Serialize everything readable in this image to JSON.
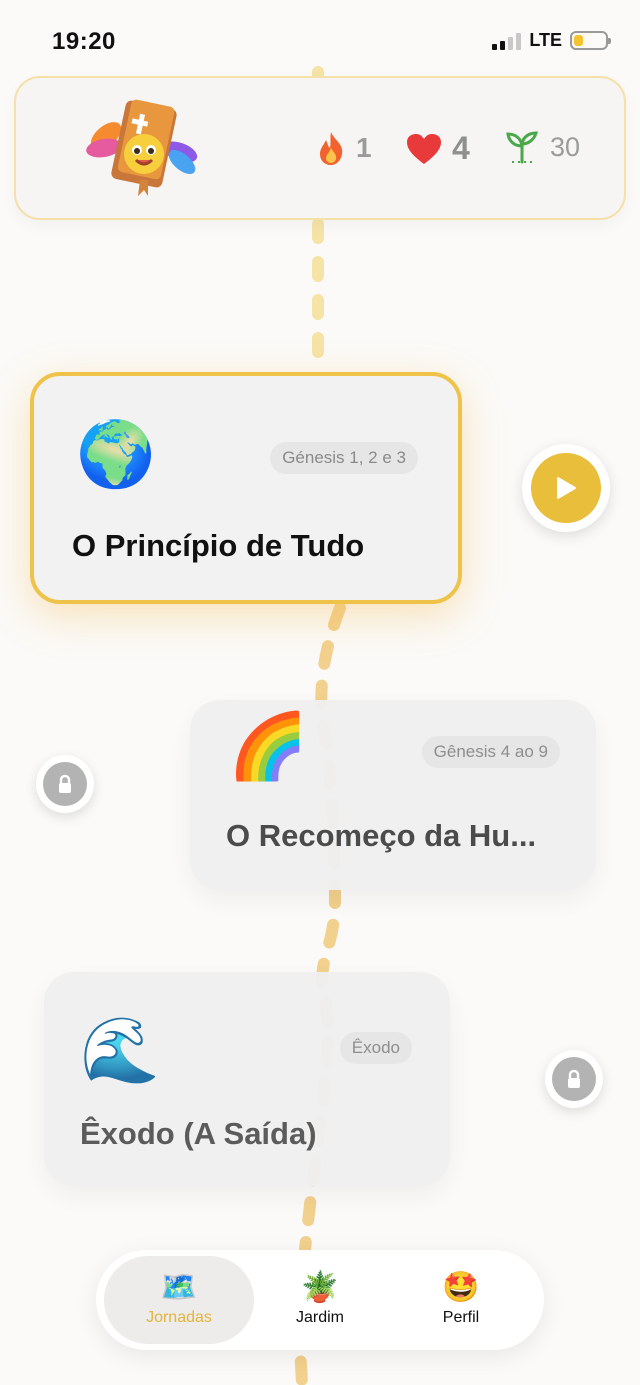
{
  "status_bar": {
    "time": "19:20",
    "network": "LTE"
  },
  "header": {
    "streak": "1",
    "lives": "4",
    "seeds": "30"
  },
  "journeys": [
    {
      "emoji": "🌍",
      "reference": "Génesis 1, 2 e 3",
      "title": "O Princípio de Tudo",
      "state": "active"
    },
    {
      "emoji": "🌈",
      "reference": "Gênesis 4 ao 9",
      "title": "O Recomeço da Hu...",
      "state": "locked"
    },
    {
      "emoji": "🌊",
      "reference": "Êxodo",
      "title": "Êxodo (A Saída)",
      "state": "locked"
    }
  ],
  "tabbar": {
    "tabs": [
      {
        "label": "Jornadas",
        "icon": "🗺️",
        "selected": true
      },
      {
        "label": "Jardim",
        "icon": "🪴",
        "selected": false
      },
      {
        "label": "Perfil",
        "icon": "🤩",
        "selected": false
      }
    ]
  },
  "colors": {
    "accent": "#e9be3b",
    "path": "#f3d98a",
    "locked": "#b3b3b3"
  }
}
